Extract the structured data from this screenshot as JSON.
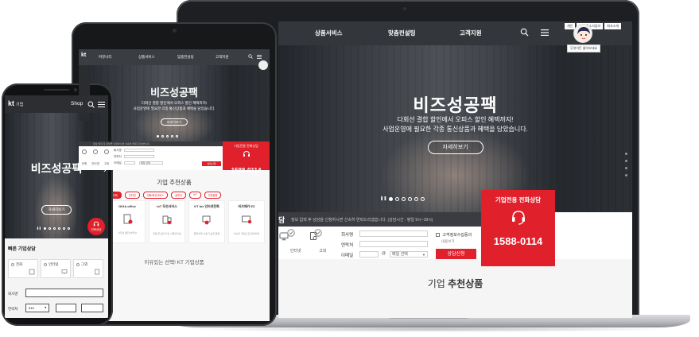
{
  "laptop": {
    "top_links": [
      "개인",
      "기업/중소사업자",
      "회사소개"
    ],
    "nav": [
      "상품서비스",
      "맞춤컨설팅",
      "고객지원"
    ],
    "avatar_tag": "무엇이든 물어보세요",
    "hero": {
      "title": "비즈성공팩",
      "sub1": "다회선 결합 할인에서 오피스 할인 혜택까지!",
      "sub2": "사업운영에 필요한 각종 통신상품과 혜택을 담았습니다.",
      "button": "자세히보기"
    },
    "consult": {
      "label": "담",
      "info": "정보 입력 후 상담을 신청하시면 신속히 연락드리겠습니다. (상담시간 : 평일 9시~18시)",
      "channels": [
        "인터넷",
        "고외"
      ],
      "fields": {
        "company_label": "회사명",
        "contact_label": "연락처",
        "email_label": "이메일",
        "email_at": "@",
        "email_select": "메일 선택"
      },
      "agree": "고객정보수집동의",
      "agree_detail": "내용보기",
      "submit": "상담신청"
    },
    "phone_box": {
      "title": "기업전용 전화상담",
      "number": "1588-0114"
    },
    "recommend": {
      "prefix": "기업",
      "bold": "추천상품"
    }
  },
  "tablet": {
    "logo": "kt",
    "nav": [
      "커뮤니티",
      "상품서비스",
      "맞춤컨설팅",
      "고객지원"
    ],
    "hero": {
      "title": "비즈성공팩",
      "sub1": "다회선 결합 할인에서 오피스 할인 혜택까지!",
      "sub2": "사업운영에 필요한 각종 통신상품과 혜택을 담았습니다.",
      "button": "자세히보기"
    },
    "bar": "정보 입력 후 상담을 신청하시면 신속히 연락드리겠습니다.",
    "form": {
      "company_label": "회사명",
      "contact_label": "연락처",
      "email_label": "이메일",
      "email_select": "메일 선택",
      "channels": [
        "전화",
        "인터넷",
        "고외"
      ],
      "submit": "상담신청"
    },
    "phone_box": {
      "title": "기업전용 전화상담",
      "number": "1588-0114"
    },
    "recommend_title": "기업 추천상품",
    "tabs": [
      "전체",
      "인터넷",
      "전화/회선서비스",
      "솔루션",
      "IoT",
      "기업용품"
    ],
    "cards": [
      {
        "name": "GiGA office",
        "desc": "사무실 통합 솔루션"
      },
      {
        "name": "IoT 무선서비스",
        "desc": "전용 무선망 기반 사물인터넷"
      },
      {
        "name": "KT biz 인터넷전화",
        "desc": "알뜰하게 사용 가능한 통화"
      },
      {
        "name": "비즈메카 EZ",
        "desc": "하나의 계정으로 편리하게"
      }
    ],
    "more": "이유있는 선택! KT 기업상품"
  },
  "phone": {
    "logo": "kt",
    "logo_sub": "기업",
    "shop": "Shop",
    "hero": {
      "title": "비즈성공팩",
      "button": "자세히보기"
    },
    "call_label": "전화상담",
    "section_title": "빠른 기업상담",
    "channels": [
      "전화",
      "인터넷",
      "그외"
    ],
    "company_label": "회사명",
    "contact_label": "연락처",
    "contact_prefix": "010"
  }
}
